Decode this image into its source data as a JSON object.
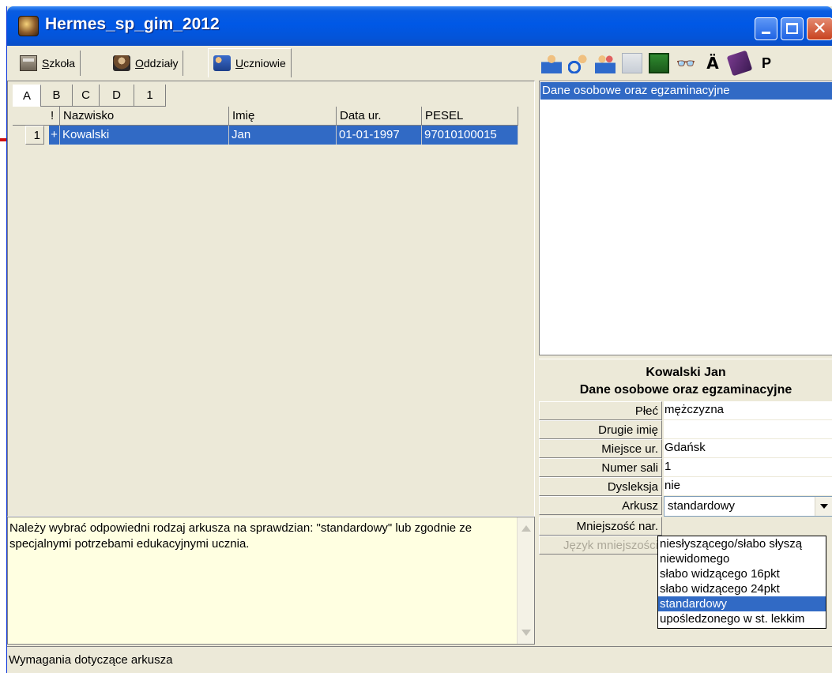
{
  "window": {
    "title": "Hermes_sp_gim_2012"
  },
  "tabs": [
    {
      "label_pre": "",
      "label_u": "S",
      "label_post": "zkoła"
    },
    {
      "label_pre": "",
      "label_u": "O",
      "label_post": "ddziały"
    },
    {
      "label_pre": "",
      "label_u": "U",
      "label_post": "czniowie"
    }
  ],
  "letter_tabs": [
    "A",
    "B",
    "C",
    "D",
    "1"
  ],
  "table": {
    "headers": [
      "!",
      "Nazwisko",
      "Imię",
      "Data ur.",
      "PESEL"
    ],
    "rows": [
      {
        "num": "1",
        "mark": "+",
        "nazwisko": "Kowalski",
        "imie": "Jan",
        "data_ur": "01-01-1997",
        "pesel": "97010100015"
      }
    ]
  },
  "description": "Należy wybrać odpowiedni rodzaj arkusza na sprawdzian: \"standardowy\" lub zgodnie ze specjalnymi potrzebami edukacyjnymi ucznia.",
  "status": "Wymagania dotyczące arkusza",
  "toolbar": {
    "icons": [
      "add-student-icon",
      "cut-student-icon",
      "group-icon",
      "copy-doc-icon",
      "save-icon",
      "binoculars-icon",
      "a-umlaut-icon",
      "book-icon",
      "p-icon"
    ],
    "a_label": "Ä",
    "p_label": "P"
  },
  "list": {
    "items": [
      "Dane osobowe oraz egzaminacyjne"
    ]
  },
  "info": {
    "name": "Kowalski Jan",
    "subtitle": "Dane osobowe oraz egzaminacyjne"
  },
  "props": [
    {
      "label": "Płeć",
      "value": "mężczyzna"
    },
    {
      "label": "Drugie imię",
      "value": ""
    },
    {
      "label": "Miejsce ur.",
      "value": "Gdańsk"
    },
    {
      "label": "Numer sali",
      "value": "1"
    },
    {
      "label": "Dysleksja",
      "value": "nie"
    },
    {
      "label": "Arkusz",
      "value": "standardowy"
    },
    {
      "label": "Mniejszość nar.",
      "value": ""
    },
    {
      "label": "Język mniejszości",
      "value": ""
    }
  ],
  "dropdown": {
    "options": [
      "niesłyszącego/słabo słyszą",
      "niewidomego",
      "słabo widzącego 16pkt",
      "słabo widzącego 24pkt",
      "standardowy",
      "upośledzonego w st. lekkim"
    ],
    "selected_index": 4
  },
  "colors": {
    "selection": "#316ac5",
    "titlebar": "#0058e6",
    "face": "#ece9d8",
    "info_bg": "#ffffe1"
  }
}
